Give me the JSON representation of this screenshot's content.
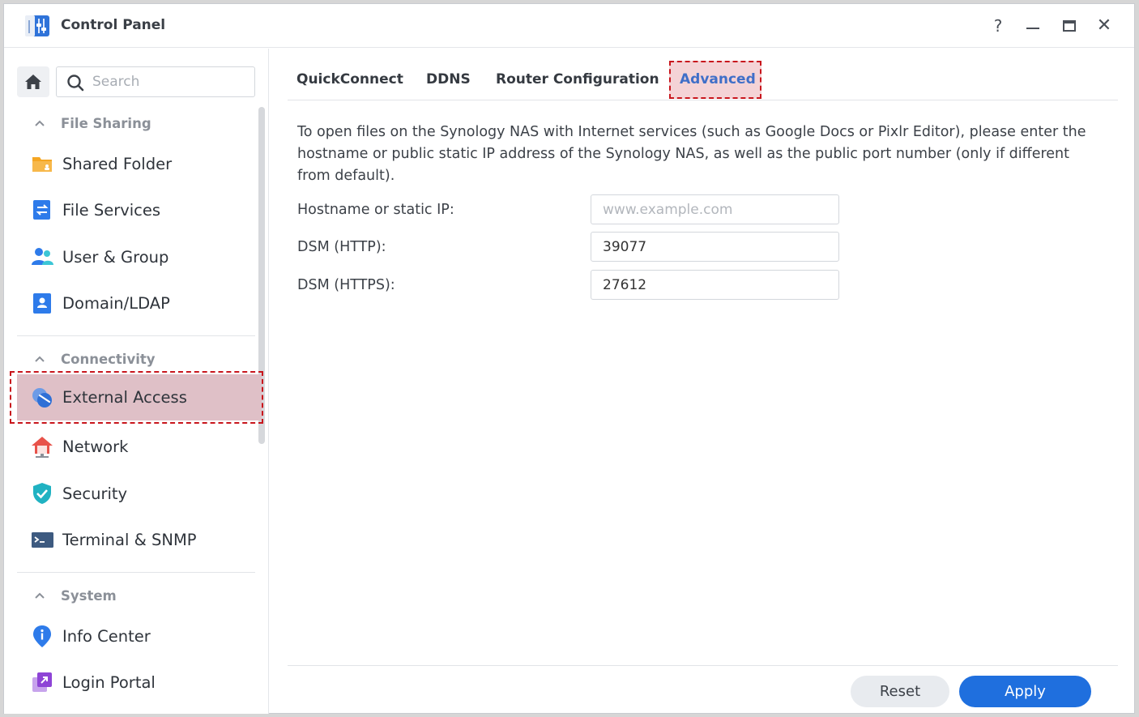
{
  "window": {
    "title": "Control Panel",
    "controls": {
      "help": "?",
      "close": "✕"
    }
  },
  "sidebar": {
    "search": {
      "placeholder": "Search"
    },
    "sections": [
      {
        "label": "File Sharing",
        "items": [
          {
            "label": "Shared Folder",
            "icon": "shared-folder-icon"
          },
          {
            "label": "File Services",
            "icon": "file-services-icon"
          },
          {
            "label": "User & Group",
            "icon": "user-group-icon"
          },
          {
            "label": "Domain/LDAP",
            "icon": "domain-ldap-icon"
          }
        ]
      },
      {
        "label": "Connectivity",
        "items": [
          {
            "label": "External Access",
            "icon": "external-access-icon",
            "selected": true
          },
          {
            "label": "Network",
            "icon": "network-icon"
          },
          {
            "label": "Security",
            "icon": "security-shield-icon"
          },
          {
            "label": "Terminal & SNMP",
            "icon": "terminal-icon"
          }
        ]
      },
      {
        "label": "System",
        "items": [
          {
            "label": "Info Center",
            "icon": "info-center-icon"
          },
          {
            "label": "Login Portal",
            "icon": "login-portal-icon"
          }
        ]
      }
    ]
  },
  "main": {
    "tabs": [
      {
        "label": "QuickConnect"
      },
      {
        "label": "DDNS"
      },
      {
        "label": "Router Configuration"
      },
      {
        "label": "Advanced",
        "active": true
      }
    ],
    "description": "To open files on the Synology NAS with Internet services (such as Google Docs or Pixlr Editor), please enter the hostname or public static IP address of the Synology NAS, as well as the public port number (only if different from default).",
    "fields": [
      {
        "label": "Hostname or static IP:",
        "value": "",
        "placeholder": "www.example.com"
      },
      {
        "label": "DSM (HTTP):",
        "value": "39077",
        "placeholder": ""
      },
      {
        "label": "DSM (HTTPS):",
        "value": "27612",
        "placeholder": ""
      }
    ],
    "buttons": {
      "reset": "Reset",
      "apply": "Apply"
    }
  },
  "colors": {
    "accent": "#1f6fde",
    "active_tab_text": "#3f6fc8",
    "highlight_border": "#c8161d",
    "selected_item_bg": "#dfc0c7"
  }
}
